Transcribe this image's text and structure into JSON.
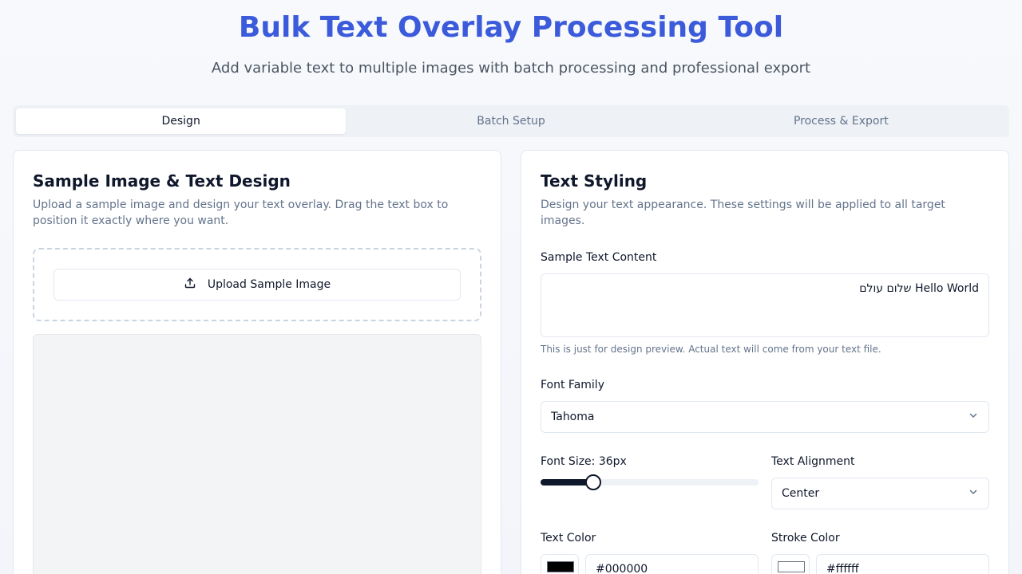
{
  "header": {
    "title": "Bulk Text Overlay Processing Tool",
    "subtitle": "Add variable text to multiple images with batch processing and professional export"
  },
  "tabs": [
    {
      "label": "Design",
      "active": true
    },
    {
      "label": "Batch Setup",
      "active": false
    },
    {
      "label": "Process & Export",
      "active": false
    }
  ],
  "left_panel": {
    "title": "Sample Image & Text Design",
    "description": "Upload a sample image and design your text overlay. Drag the text box to position it exactly where you want.",
    "upload_label": "Upload Sample Image",
    "upload_icon": "upload-icon"
  },
  "right_panel": {
    "title": "Text Styling",
    "description": "Design your text appearance. These settings will be applied to all target images.",
    "sample_text_label": "Sample Text Content",
    "sample_text_value": "Hello World שלום עולם",
    "sample_text_hint": "This is just for design preview. Actual text will come from your text file.",
    "font_family_label": "Font Family",
    "font_family_value": "Tahoma",
    "font_size_label": "Font Size: 36px",
    "font_size_fraction": 0.24,
    "text_alignment_label": "Text Alignment",
    "text_alignment_value": "Center",
    "text_color_label": "Text Color",
    "text_color_value": "#000000",
    "stroke_color_label": "Stroke Color",
    "stroke_color_value": "#ffffff"
  },
  "colors": {
    "accent": "#3b5bdb",
    "slider": "#0f172a"
  }
}
